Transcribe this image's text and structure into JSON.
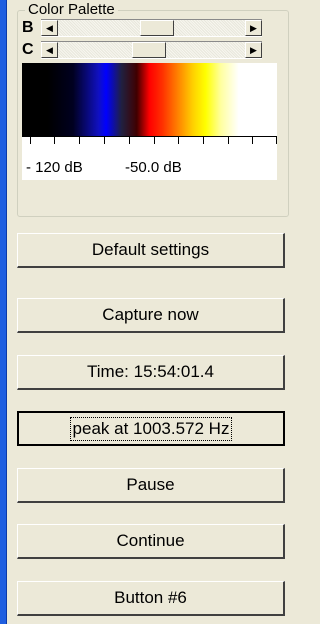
{
  "group": {
    "legend": "Color Palette"
  },
  "sliders": [
    {
      "label": "B",
      "value_fraction": 0.47
    },
    {
      "label": "C",
      "value_fraction": 0.43
    }
  ],
  "scale": {
    "label_min": "- 120 dB",
    "label_max": "-50.0 dB"
  },
  "buttons": {
    "default": "Default settings",
    "capture": "Capture now",
    "time": "Time:  15:54:01.4",
    "peak": "peak at 1003.572 Hz",
    "pause": "Pause",
    "continue": "Continue",
    "button6": "Button #6"
  },
  "colors": {
    "window_bg": "#ece9d8",
    "stripe": "#1f5fe0"
  }
}
